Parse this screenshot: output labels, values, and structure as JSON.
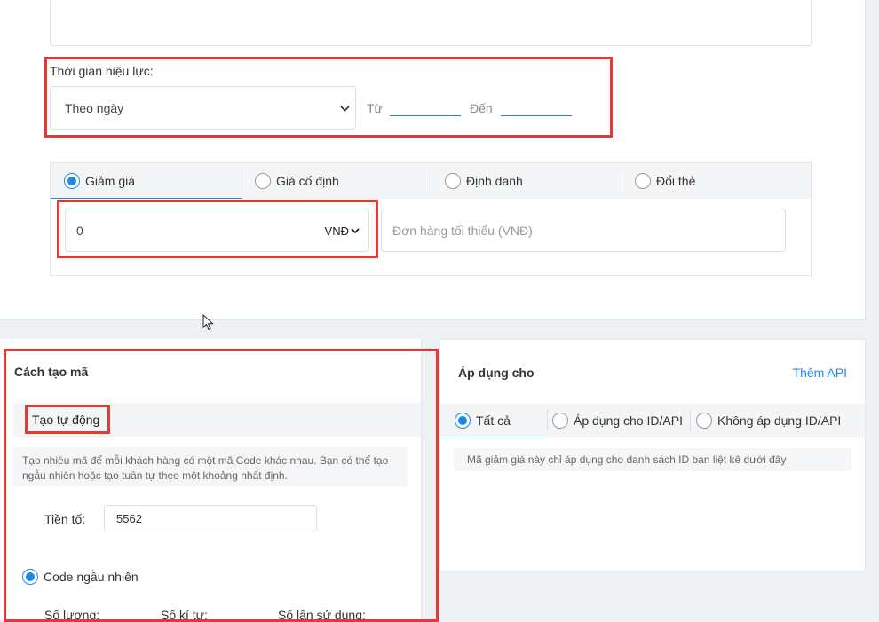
{
  "validity": {
    "label": "Thời gian hiệu lực:",
    "select_value": "Theo ngày",
    "from_label": "Từ",
    "to_label": "Đến"
  },
  "discount": {
    "tabs": [
      {
        "label": "Giảm giá",
        "selected": true
      },
      {
        "label": "Giá cố định",
        "selected": false
      },
      {
        "label": "Định danh",
        "selected": false
      },
      {
        "label": "Đổi thẻ",
        "selected": false
      }
    ],
    "amount_value": "0",
    "currency": "VNĐ",
    "min_order_placeholder": "Đơn hàng tối thiểu (VNĐ)"
  },
  "code_creation": {
    "title": "Cách tạo mã",
    "tab_label": "Tạo tự động",
    "hint": "Tạo nhiều mã để mỗi khách hàng có một mã Code khác nhau. Bạn có thể tạo ngẫu nhiên hoặc tạo tuần tự theo một khoảng nhất định.",
    "prefix_label": "Tiền tố:",
    "prefix_value": "5562",
    "random_label": "Code ngẫu nhiên",
    "quantity_label": "Số lượng:",
    "length_label": "Số kí tự:",
    "usage_label": "Số lần sử dụng:"
  },
  "apply_for": {
    "title": "Áp dụng cho",
    "add_api": "Thêm API",
    "tabs": [
      {
        "label": "Tất cả",
        "selected": true
      },
      {
        "label": "Áp dụng cho ID/API",
        "selected": false
      },
      {
        "label": "Không áp dụng ID/API",
        "selected": false
      }
    ],
    "hint": "Mã giảm giá này chỉ áp dụng cho danh sách ID bạn liệt kê dưới đây"
  },
  "colors": {
    "accent": "#1e88e5",
    "highlight": "#e53935"
  }
}
